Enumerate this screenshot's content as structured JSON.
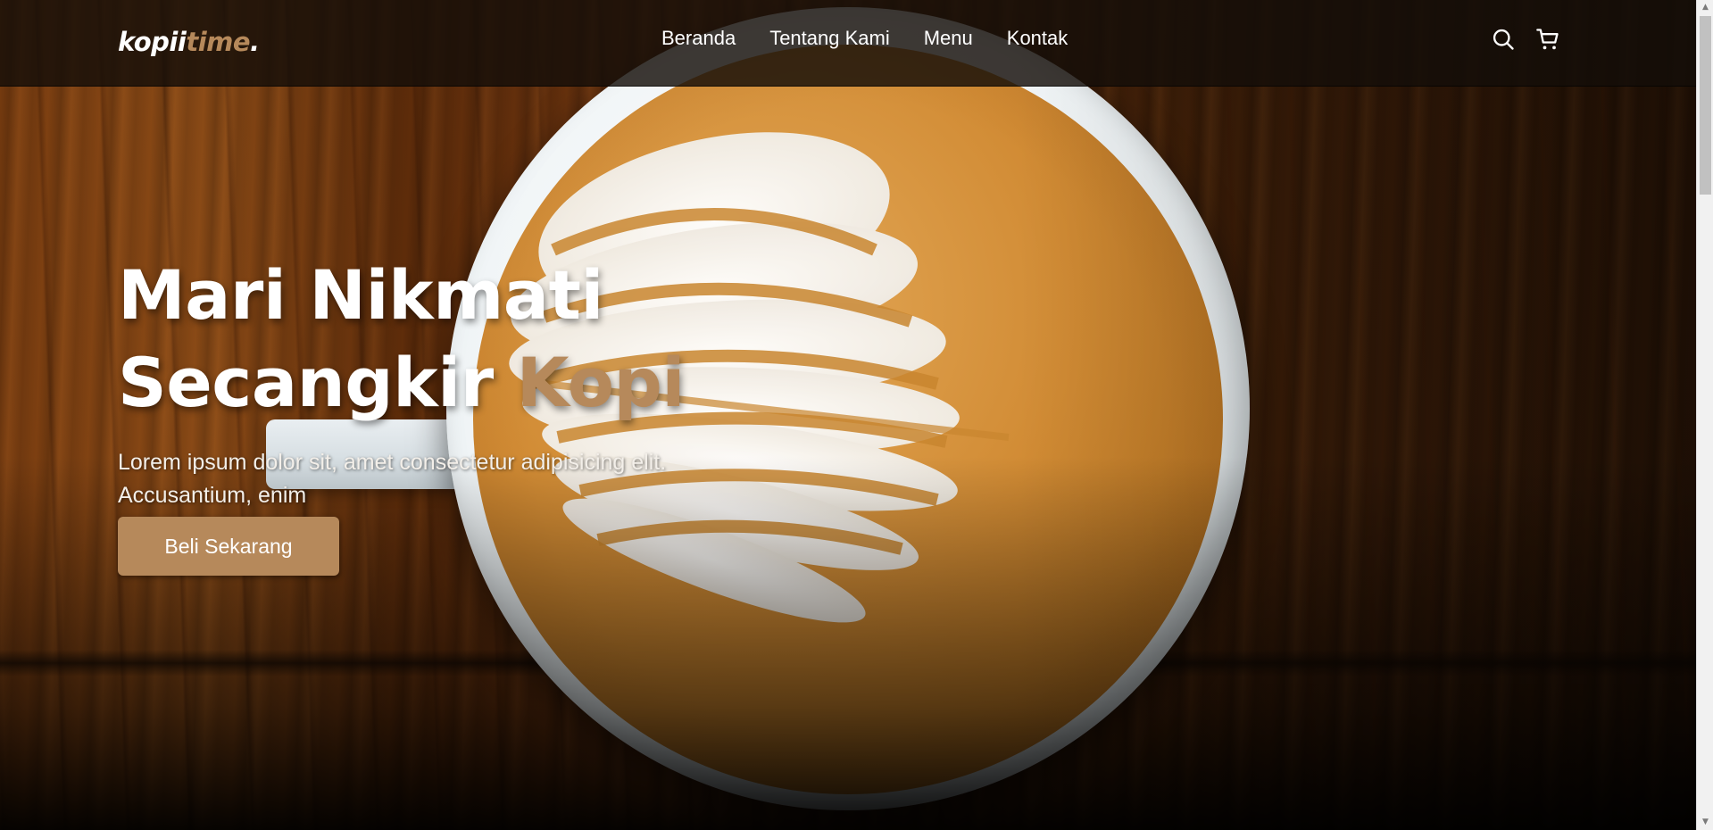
{
  "brand": {
    "name_part1": "kopii",
    "name_part2": "time",
    "name_suffix": "."
  },
  "nav": {
    "links": [
      "Beranda",
      "Tentang Kami",
      "Menu",
      "Kontak"
    ],
    "icons": [
      "search-icon",
      "cart-icon"
    ]
  },
  "hero": {
    "title_line1": "Mari Nikmati",
    "title_line2_plain": "Secangkir ",
    "title_line2_accent": "Kopi",
    "description": "Lorem ipsum dolor sit, amet consectetur adipisicing elit. Accusantium, enim",
    "cta_label": "Beli Sekarang"
  },
  "colors": {
    "accent": "#b6895b",
    "navbar_bg": "rgba(20,14,8,0.82)",
    "text_light": "#ffffff"
  }
}
